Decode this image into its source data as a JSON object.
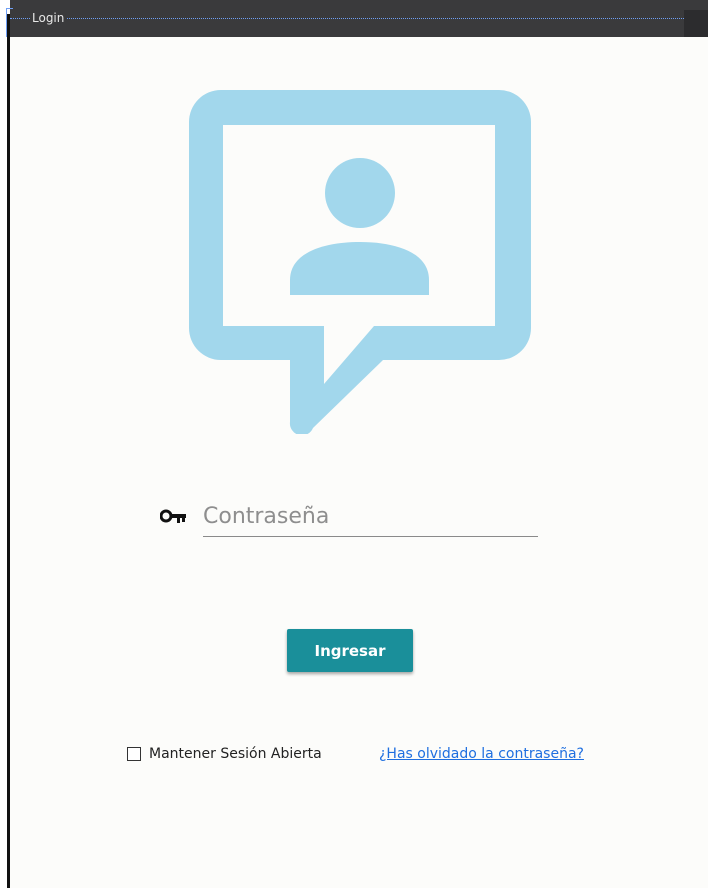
{
  "window": {
    "title": "Login"
  },
  "colors": {
    "accent": "#1a8f9a",
    "icon": "#a2d7ec",
    "link": "#1f6fe0",
    "titlebar": "#3a3a3c"
  },
  "illustration": {
    "icon_name": "user-speech-bubble-icon"
  },
  "password": {
    "icon_name": "key-icon",
    "placeholder": "Contraseña",
    "value": ""
  },
  "login_button": {
    "label": "Ingresar"
  },
  "remember": {
    "label": "Mantener Sesión Abierta",
    "checked": false
  },
  "forgot_link": {
    "label": "¿Has olvidado la contraseña?"
  }
}
